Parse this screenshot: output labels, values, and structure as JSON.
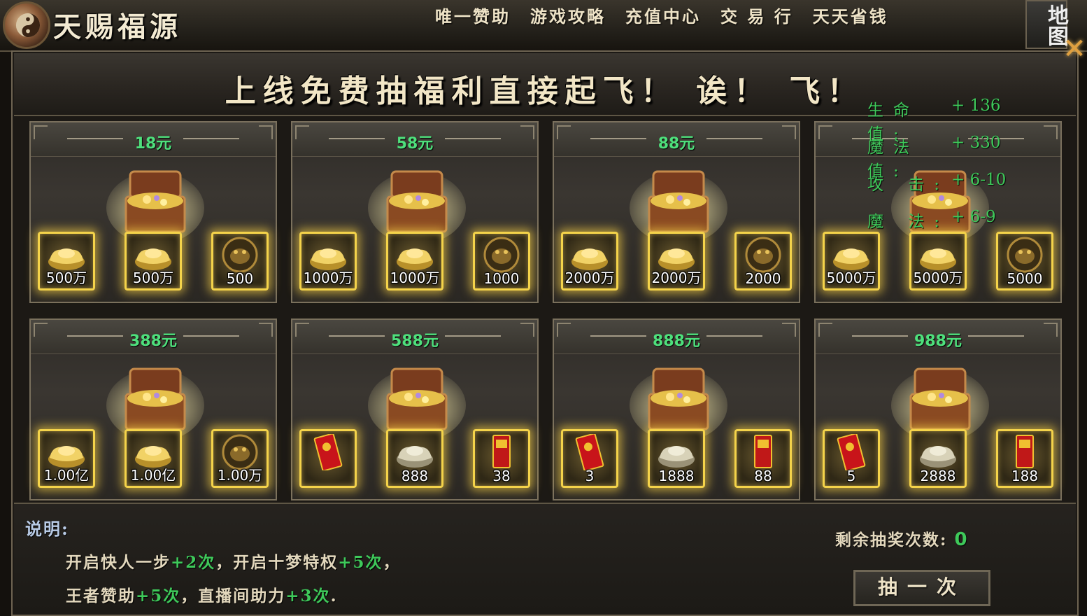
{
  "app": {
    "title": "天赐福源"
  },
  "nav": [
    {
      "label": "唯一赞助"
    },
    {
      "label": "游戏攻略"
    },
    {
      "label": "充值中心"
    },
    {
      "label": "交 易 行"
    },
    {
      "label": "天天省钱"
    }
  ],
  "map_button": {
    "label": "地图"
  },
  "close_icon": "close-icon",
  "banner": {
    "text": "上线免费抽福利直接起飞！ 诶！ 飞！"
  },
  "stats": [
    {
      "label": "生命值:",
      "value": "+ 136"
    },
    {
      "label": "魔法值:",
      "value": "+ 330"
    },
    {
      "label": "攻  击:",
      "value": "+ 6-10"
    },
    {
      "label": "魔  法:",
      "value": "+ 6-9"
    }
  ],
  "cards": [
    {
      "price": "18元",
      "slots": [
        {
          "icon": "gold-ingot-icon",
          "label": "500万"
        },
        {
          "icon": "gold-ingot-icon",
          "label": "500万"
        },
        {
          "icon": "toad-coin-icon",
          "label": "500"
        }
      ]
    },
    {
      "price": "58元",
      "slots": [
        {
          "icon": "gold-ingot-icon",
          "label": "1000万"
        },
        {
          "icon": "gold-ingot-icon",
          "label": "1000万"
        },
        {
          "icon": "toad-coin-icon",
          "label": "1000"
        }
      ]
    },
    {
      "price": "88元",
      "slots": [
        {
          "icon": "gold-ingot-icon",
          "label": "2000万"
        },
        {
          "icon": "gold-ingot-icon",
          "label": "2000万"
        },
        {
          "icon": "toad-coin-icon",
          "label": "2000"
        }
      ]
    },
    {
      "price": "",
      "slots": [
        {
          "icon": "gold-ingot-icon",
          "label": "5000万"
        },
        {
          "icon": "gold-ingot-icon",
          "label": "5000万"
        },
        {
          "icon": "toad-coin-icon",
          "label": "5000"
        }
      ]
    },
    {
      "price": "388元",
      "slots": [
        {
          "icon": "gold-ingot-icon",
          "label": "1.00亿"
        },
        {
          "icon": "gold-ingot-icon",
          "label": "1.00亿"
        },
        {
          "icon": "toad-coin-icon",
          "label": "1.00万"
        }
      ]
    },
    {
      "price": "588元",
      "slots": [
        {
          "icon": "red-envelope-icon",
          "label": ""
        },
        {
          "icon": "silver-ingot-icon",
          "label": "888"
        },
        {
          "icon": "red-token-icon",
          "label": "38"
        }
      ]
    },
    {
      "price": "888元",
      "slots": [
        {
          "icon": "red-envelope-icon",
          "label": "3"
        },
        {
          "icon": "silver-ingot-icon",
          "label": "1888"
        },
        {
          "icon": "red-token-icon",
          "label": "88"
        }
      ]
    },
    {
      "price": "988元",
      "slots": [
        {
          "icon": "red-envelope-icon",
          "label": "5"
        },
        {
          "icon": "silver-ingot-icon",
          "label": "2888"
        },
        {
          "icon": "red-token-icon",
          "label": "188"
        }
      ]
    }
  ],
  "footer": {
    "desc_title": "说明:",
    "line1": {
      "a": "开启快人一步",
      "a_bonus": "+2次",
      "sep1": "，",
      "b": "开启十梦特权",
      "b_bonus": "+5次",
      "end": "，"
    },
    "line2": {
      "a": "王者赞助",
      "a_bonus": "+5次",
      "sep1": "，",
      "b": "直播间助力",
      "b_bonus": "+3次",
      "end": "."
    },
    "remain_label": "剩余抽奖次数:",
    "remain_value": "0",
    "draw_button": "抽一次"
  },
  "colors": {
    "accent_green": "#3ec95a",
    "slot_gold": "#f4d34a",
    "frame": "#6e6452"
  }
}
